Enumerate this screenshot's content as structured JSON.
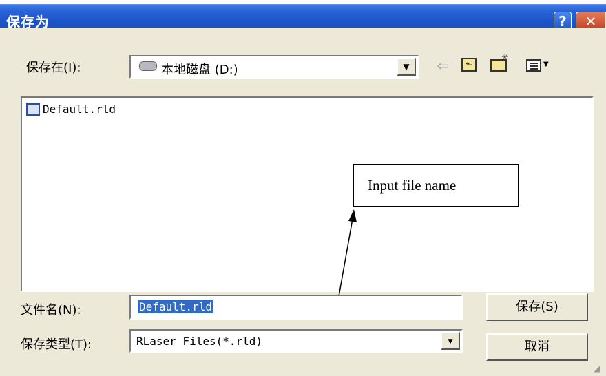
{
  "window": {
    "title": "保存为"
  },
  "title_buttons": {
    "help": "?",
    "close": "✕"
  },
  "save_in": {
    "label": "保存在(I):",
    "value": "本地磁盘 (D:)"
  },
  "toolbar": {
    "back": "back-arrow-icon",
    "up": "up-folder-icon",
    "new_folder": "new-folder-icon",
    "view": "view-menu-icon"
  },
  "files": [
    {
      "name": "Default.rld"
    }
  ],
  "callout": {
    "text": "Input file name"
  },
  "filename": {
    "label": "文件名(N):",
    "value": "Default.rld"
  },
  "filetype": {
    "label": "保存类型(T):",
    "value": "RLaser Files(*.rld)"
  },
  "buttons": {
    "save": "保存(S)",
    "cancel": "取消"
  }
}
